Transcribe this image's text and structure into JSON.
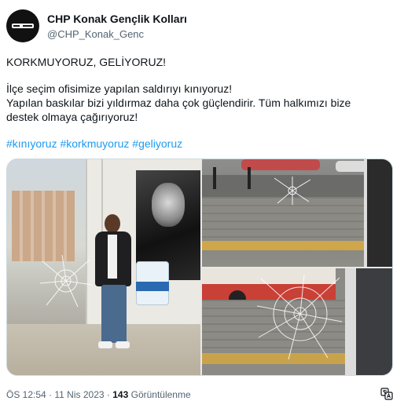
{
  "account": {
    "display_name": "CHP Konak Gençlik Kolları",
    "handle": "@CHP_Konak_Genc",
    "avatar_icon": "chp-logo-avatar"
  },
  "tweet": {
    "title_line": "KORKMUYORUZ, GELİYORUZ!",
    "body_line1": "İlçe seçim ofisimize yapılan saldırıyı kınıyoruz!",
    "body_line2": "Yapılan baskılar bizi yıldırmaz daha çok güçlendirir. Tüm halkımızı bize",
    "body_line3": "destek olmaya çağırıyoruz!",
    "hashtags": [
      "#kınıyoruz",
      "#korkmuyoruz",
      "#geliyoruz"
    ]
  },
  "media": {
    "count": 3
  },
  "meta": {
    "time": "ÖS 12:54",
    "separator": "·",
    "date": "11 Nis 2023",
    "views_count": "143",
    "views_label": "Görüntülenme"
  },
  "colors": {
    "link": "#1d9bf0",
    "text": "#0f1419",
    "muted": "#536471",
    "border": "#cfd9de"
  },
  "icons": {
    "translate": "translate-icon"
  }
}
